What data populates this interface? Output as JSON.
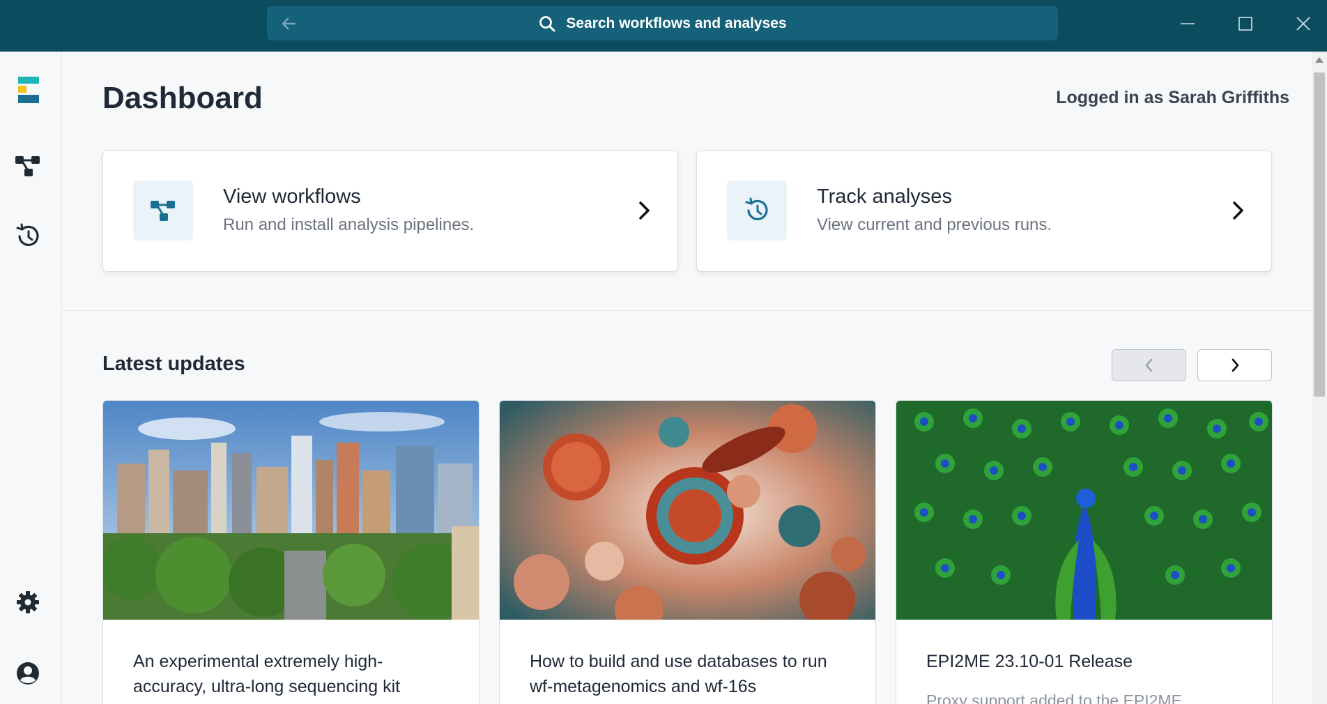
{
  "titlebar": {
    "search_label": "Search workflows and analyses",
    "back_icon": "arrow-left-icon",
    "window_controls": [
      "minimize-icon",
      "maximize-icon",
      "close-icon"
    ]
  },
  "sidebar": {
    "items": [
      {
        "name": "logo",
        "icon": "epi2me-logo"
      },
      {
        "name": "workflows",
        "icon": "workflow-icon"
      },
      {
        "name": "analyses",
        "icon": "history-icon"
      },
      {
        "name": "settings",
        "icon": "gear-icon"
      },
      {
        "name": "account",
        "icon": "user-circle-icon"
      }
    ]
  },
  "main": {
    "title": "Dashboard",
    "logged_in": "Logged in as Sarah Griffiths",
    "actions": [
      {
        "title": "View workflows",
        "subtitle": "Run and install analysis pipelines.",
        "icon": "workflow-icon"
      },
      {
        "title": "Track analyses",
        "subtitle": "View current and previous runs.",
        "icon": "history-icon"
      }
    ],
    "updates_title": "Latest updates",
    "updates": [
      {
        "title": "An experimental extremely high-accuracy, ultra-long sequencing kit",
        "image": "city-skyline"
      },
      {
        "title": "How to build and use databases to run wf-metagenomics and wf-16s",
        "image": "microbes"
      },
      {
        "title": "EPI2ME 23.10-01 Release",
        "excerpt": "Proxy support added to the EPI2ME",
        "image": "peacock"
      }
    ]
  },
  "colors": {
    "titlebar": "#0b4c5f",
    "searchbar": "#15617a",
    "accent": "#1b6f93",
    "logo_teal": "#1fb5b5",
    "logo_yellow": "#f2c21b",
    "logo_blue": "#1b6f93"
  }
}
